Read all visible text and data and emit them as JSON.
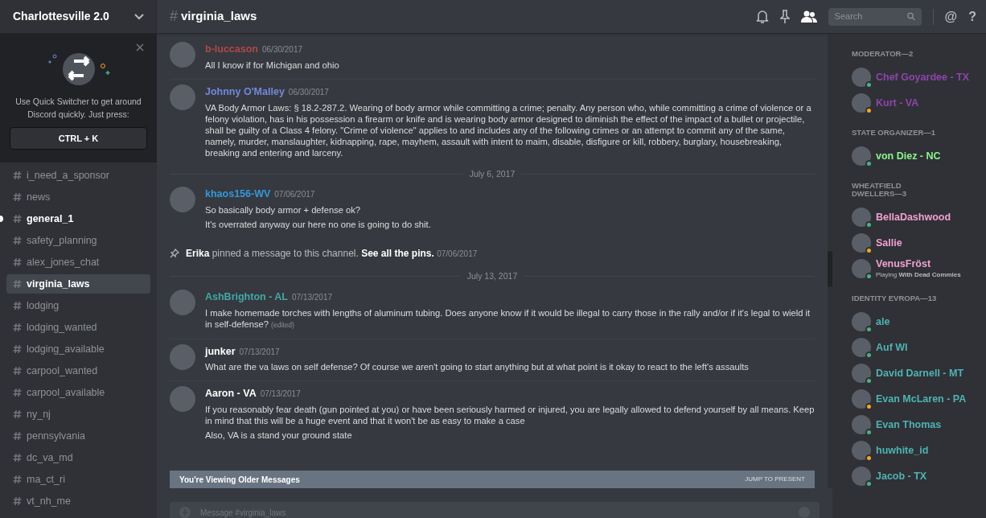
{
  "server": {
    "name": "Charlottesville 2.0"
  },
  "quick_switcher": {
    "text": "Use Quick Switcher to get around Discord quickly. Just press:",
    "shortcut": "CTRL + K"
  },
  "channels": [
    {
      "name": "i_need_a_sponsor",
      "selected": false,
      "unread": false
    },
    {
      "name": "news",
      "selected": false,
      "unread": false
    },
    {
      "name": "general_1",
      "selected": false,
      "unread": true
    },
    {
      "name": "safety_planning",
      "selected": false,
      "unread": false
    },
    {
      "name": "alex_jones_chat",
      "selected": false,
      "unread": false
    },
    {
      "name": "virginia_laws",
      "selected": true,
      "unread": false
    },
    {
      "name": "lodging",
      "selected": false,
      "unread": false
    },
    {
      "name": "lodging_wanted",
      "selected": false,
      "unread": false
    },
    {
      "name": "lodging_available",
      "selected": false,
      "unread": false
    },
    {
      "name": "carpool_wanted",
      "selected": false,
      "unread": false
    },
    {
      "name": "carpool_available",
      "selected": false,
      "unread": false
    },
    {
      "name": "ny_nj",
      "selected": false,
      "unread": false
    },
    {
      "name": "pennsylvania",
      "selected": false,
      "unread": false
    },
    {
      "name": "dc_va_md",
      "selected": false,
      "unread": false
    },
    {
      "name": "ma_ct_ri",
      "selected": false,
      "unread": false
    },
    {
      "name": "vt_nh_me",
      "selected": false,
      "unread": false
    }
  ],
  "header": {
    "hash": "#",
    "channel": "virginia_laws",
    "search_placeholder": "Search",
    "mention": "@",
    "help": "?"
  },
  "messages": [
    {
      "kind": "message",
      "author": "b-luccason",
      "color": "#b04848",
      "time": "06/30/2017",
      "lines": [
        "All I know if for Michigan and ohio"
      ]
    },
    {
      "kind": "message",
      "author": "Johnny O'Malley",
      "color": "#7289da",
      "time": "06/30/2017",
      "lines": [
        "VA Body Armor Laws: § 18.2-287.2. Wearing of body armor while committing a crime; penalty. Any person who, while committing a crime of violence or a felony violation, has in his possession a firearm or knife and is wearing body armor designed to diminish the effect of the impact of a bullet or projectile, shall be guilty of a Class 4 felony.  \"Crime of violence\" applies to and includes any of the following crimes or an attempt to commit any of the same, namely, murder, manslaughter, kidnapping, rape, mayhem, assault with intent to maim, disable, disfigure or kill, robbery, burglary, housebreaking, breaking and entering and larceny."
      ]
    },
    {
      "kind": "divider",
      "text": "July 6, 2017"
    },
    {
      "kind": "message",
      "author": "khaos156-WV",
      "color": "#3498db",
      "time": "07/06/2017",
      "lines": [
        "So basically body armor + defense ok?",
        "It's overrated anyway our here no one is going to do shit."
      ]
    },
    {
      "kind": "pin",
      "actor": "Erika",
      "text": "pinned a message to this channel.",
      "link": "See all the pins.",
      "time": "07/06/2017"
    },
    {
      "kind": "divider",
      "text": "July 13, 2017"
    },
    {
      "kind": "message",
      "author": "AshBrighton - AL",
      "color": "#3fa9a9",
      "time": "07/13/2017",
      "lines": [
        "I make homemade torches with lengths of aluminum tubing. Does anyone know if it would be illegal to carry those in the rally and/or if it's legal to wield it in self-defense?"
      ],
      "edited": "(edited)"
    },
    {
      "kind": "message",
      "author": "junker",
      "color": "#ffffff",
      "time": "07/13/2017",
      "lines": [
        "What are the va laws on self defense? Of course we aren't going to start anything but at what point is it okay to react to the left's assaults"
      ]
    },
    {
      "kind": "message",
      "author": "Aaron - VA",
      "color": "#ffffff",
      "time": "07/13/2017",
      "lines": [
        "If you reasonably fear death (gun pointed at you) or have been seriously harmed or injured, you are legally allowed to defend yourself by all means. Keep in mind that this will be a huge event and that it won't be as easy to make a case",
        "Also, VA is a stand your ground state"
      ]
    }
  ],
  "older_bar": {
    "text": "You're Viewing Older Messages",
    "action": "JUMP TO PRESENT"
  },
  "composer": {
    "placeholder": "Message #virginia_laws"
  },
  "member_groups": [
    {
      "title": "MODERATOR—2",
      "color": "#8e44ad",
      "members": [
        {
          "name": "Chef Goyardee - TX",
          "color": "#43b581"
        },
        {
          "name": "Kurt - VA",
          "color": "#faa61a"
        }
      ]
    },
    {
      "title": "STATE ORGANIZER—1",
      "color": "#8cf58c",
      "members": [
        {
          "name": "von Diez - NC",
          "color": "#43b581"
        }
      ]
    },
    {
      "title": "WHEATFIELD DWELLERS—3",
      "color": "#f0a0d0",
      "members": [
        {
          "name": "BellaDashwood",
          "color": "#43b581"
        },
        {
          "name": "Sallie",
          "color": "#faa61a"
        },
        {
          "name": "VenusFröst",
          "color": "#43b581",
          "activity": "Playing",
          "game": "With Dead Commies"
        }
      ]
    },
    {
      "title": "IDENTITY EVROPA—13",
      "color": "#4fb3b3",
      "members": [
        {
          "name": "ale",
          "color": "#43b581"
        },
        {
          "name": "Auf WI",
          "color": "#43b581"
        },
        {
          "name": "David Darnell - MT",
          "color": "#43b581"
        },
        {
          "name": "Evan McLaren - PA",
          "color": "#faa61a"
        },
        {
          "name": "Evan Thomas",
          "color": "#43b581"
        },
        {
          "name": "huwhite_id",
          "color": "#faa61a"
        },
        {
          "name": "Jacob - TX",
          "color": "#43b581"
        }
      ]
    }
  ]
}
